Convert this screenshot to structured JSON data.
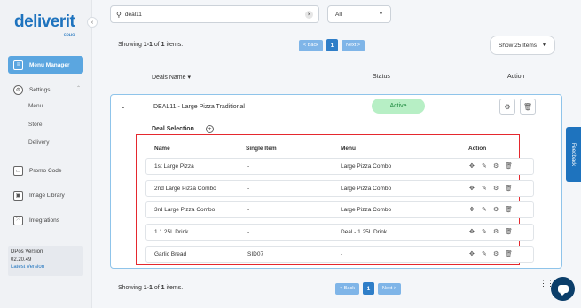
{
  "app": {
    "logo": "deliverit",
    "logo_sub": "COLIO"
  },
  "sidebar": {
    "collapse_icon": "chevron-left",
    "active_item": {
      "label": "Menu Manager",
      "icon": "menu-icon"
    },
    "settings": {
      "label": "Settings",
      "icon": "gear-icon",
      "expanded": true,
      "children": [
        "Menu",
        "Store",
        "Delivery"
      ]
    },
    "items": [
      {
        "label": "Promo Code",
        "icon": "promo-icon"
      },
      {
        "label": "Image Library",
        "icon": "image-icon"
      },
      {
        "label": "Integrations",
        "icon": "integrations-icon"
      }
    ],
    "version": {
      "label": "DPos Version",
      "number": "02.20.49",
      "link": "Latest Version"
    }
  },
  "search": {
    "value": "deal11",
    "clear_icon": "close-icon"
  },
  "filter": {
    "selected": "All"
  },
  "pagination_top": {
    "showing_prefix": "Showing ",
    "range": "1-1",
    "of": " of ",
    "total": "1",
    "suffix": " items.",
    "back": "< Back",
    "page": "1",
    "next": "Next >",
    "per_page": "Show 25 Items"
  },
  "table": {
    "headers": {
      "name": "Deals Name",
      "status": "Status",
      "action": "Action"
    },
    "deal": {
      "name": "DEAL11 - Large Pizza Traditional",
      "status": "Active",
      "status_color": "#b7efc5"
    }
  },
  "deal_selection": {
    "title": "Deal Selection",
    "headers": {
      "name": "Name",
      "single": "Single Item",
      "menu": "Menu",
      "action": "Action"
    },
    "rows": [
      {
        "name": "1st Large Pizza",
        "single": "-",
        "menu": "Large Pizza Combo"
      },
      {
        "name": "2nd Large Pizza Combo",
        "single": "-",
        "menu": "Large Pizza Combo"
      },
      {
        "name": "3rd Large Pizza Combo",
        "single": "-",
        "menu": "Large Pizza Combo"
      },
      {
        "name": "1 1.25L Drink",
        "single": "-",
        "menu": "Deal - 1.25L Drink"
      },
      {
        "name": "Garlic Bread",
        "single": "SID07",
        "menu": "-"
      }
    ]
  },
  "pagination_bottom": {
    "showing_prefix": "Showing ",
    "range": "1-1",
    "of": " of ",
    "total": "1",
    "suffix": " items.",
    "back": "< Back",
    "page": "1",
    "next": "Next >"
  },
  "feedback": {
    "label": "Feedback"
  },
  "colors": {
    "accent": "#1e73be",
    "highlight": "#e5282e",
    "active_badge": "#b7efc5"
  }
}
